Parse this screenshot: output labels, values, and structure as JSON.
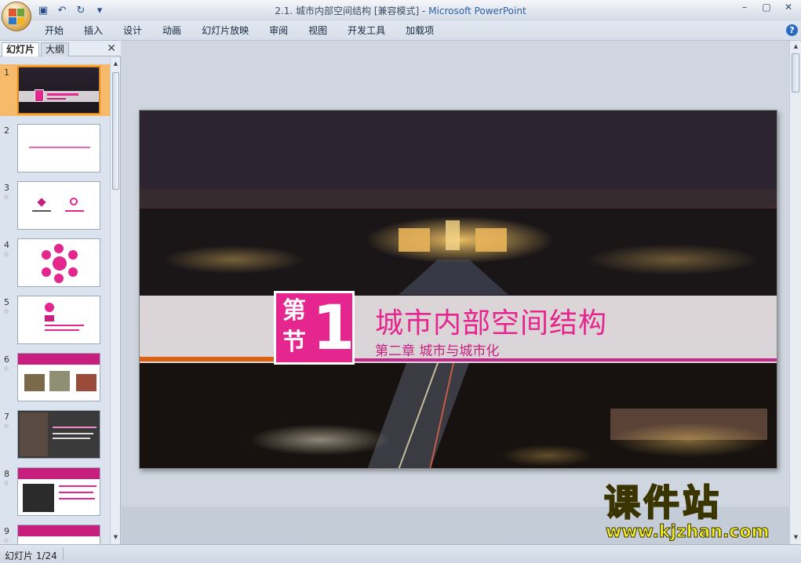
{
  "window": {
    "title": "2.1. 城市内部空间结构 [兼容模式] - ",
    "app_name": "Microsoft PowerPoint",
    "controls": [
      "–",
      "▢",
      "✕"
    ]
  },
  "quick_access": [
    {
      "name": "save-icon",
      "glyph": "▣"
    },
    {
      "name": "undo-icon",
      "glyph": "↶"
    },
    {
      "name": "redo-icon",
      "glyph": "↻"
    },
    {
      "name": "customize-icon",
      "glyph": "▾"
    }
  ],
  "ribbon": {
    "tabs": [
      "开始",
      "插入",
      "设计",
      "动画",
      "幻灯片放映",
      "审阅",
      "视图",
      "开发工具",
      "加载项"
    ],
    "help": "?"
  },
  "left_pane": {
    "tabs": [
      "幻灯片",
      "大纲"
    ],
    "close": "✕",
    "slides": [
      {
        "num": "1",
        "selected": true
      },
      {
        "num": "2"
      },
      {
        "num": "3"
      },
      {
        "num": "4"
      },
      {
        "num": "5"
      },
      {
        "num": "6"
      },
      {
        "num": "7"
      },
      {
        "num": "8"
      },
      {
        "num": "9"
      }
    ],
    "star": "☆"
  },
  "slide": {
    "badge_top": "第",
    "badge_bottom": "节",
    "badge_number": "1",
    "title": "城市内部空间结构",
    "subtitle": "第二章  城市与城市化"
  },
  "watermark": {
    "title": "课件站",
    "url": "www.kjzhan.com"
  },
  "status": {
    "slide_info": "幻灯片 1/24"
  },
  "colors": {
    "accent": "#e4268e",
    "orange": "#e06010",
    "ribbon": "#d6dee9"
  }
}
